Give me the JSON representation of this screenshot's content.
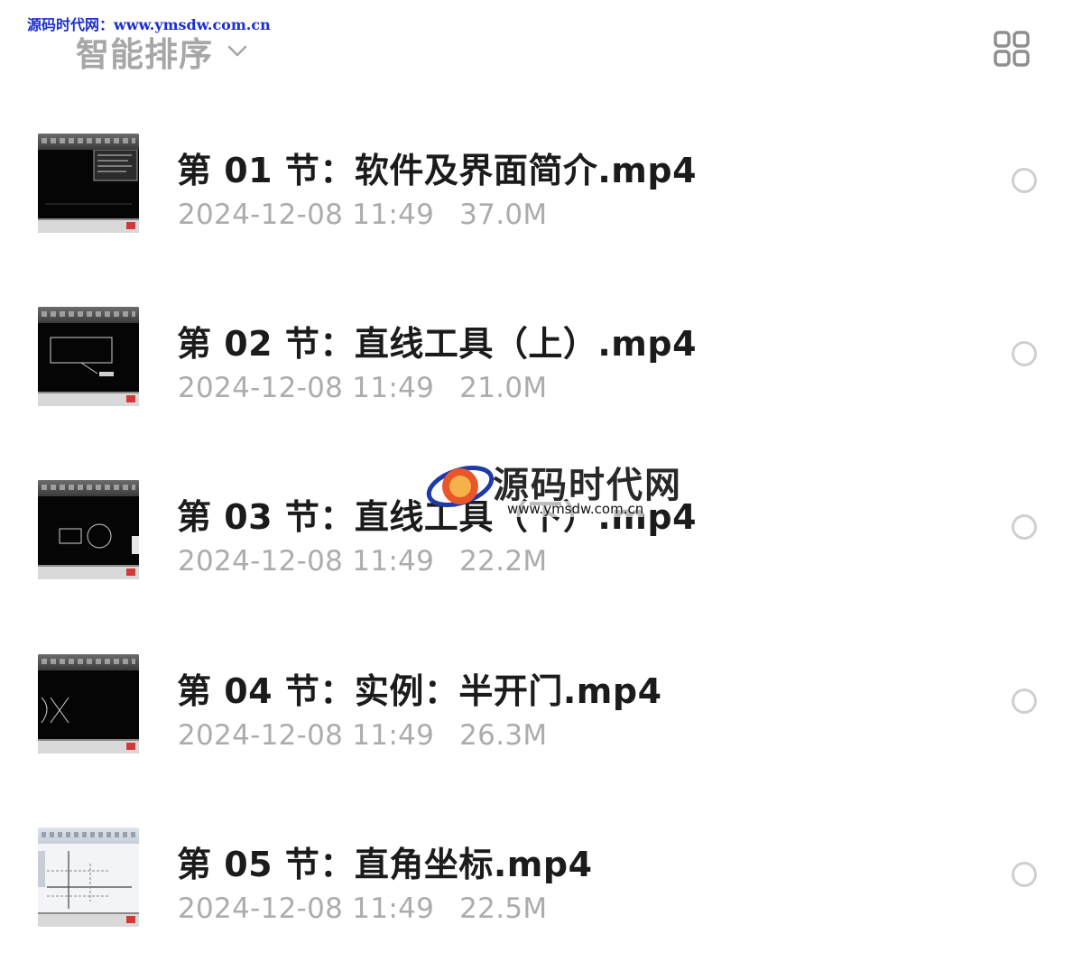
{
  "watermark": {
    "top_text": "源码时代网：www.ymsdw.com.cn",
    "logo_text": "源码时代网",
    "logo_url": "www.ymsdw.com.cn"
  },
  "toolbar": {
    "sort_label": "智能排序",
    "sort_icon": "chevron-down-icon",
    "view_toggle_icon": "grid-view-icon"
  },
  "files": [
    {
      "title": "第 01 节：软件及界面简介.mp4",
      "date": "2024-12-08 11:49",
      "size": "37.0M",
      "selected": false,
      "thumbnail": "dark-cad-menu"
    },
    {
      "title": "第 02 节：直线工具（上）.mp4",
      "date": "2024-12-08 11:49",
      "size": "21.0M",
      "selected": false,
      "thumbnail": "dark-cad-rect"
    },
    {
      "title": "第 03 节：直线工具（下）.mp4",
      "date": "2024-12-08 11:49",
      "size": "22.2M",
      "selected": false,
      "thumbnail": "dark-cad-circle"
    },
    {
      "title": "第 04 节：实例：半开门.mp4",
      "date": "2024-12-08 11:49",
      "size": "26.3M",
      "selected": false,
      "thumbnail": "dark-cad-door"
    },
    {
      "title": "第 05 节：直角坐标.mp4",
      "date": "2024-12-08 11:49",
      "size": "22.5M",
      "selected": false,
      "thumbnail": "light-axes"
    }
  ]
}
